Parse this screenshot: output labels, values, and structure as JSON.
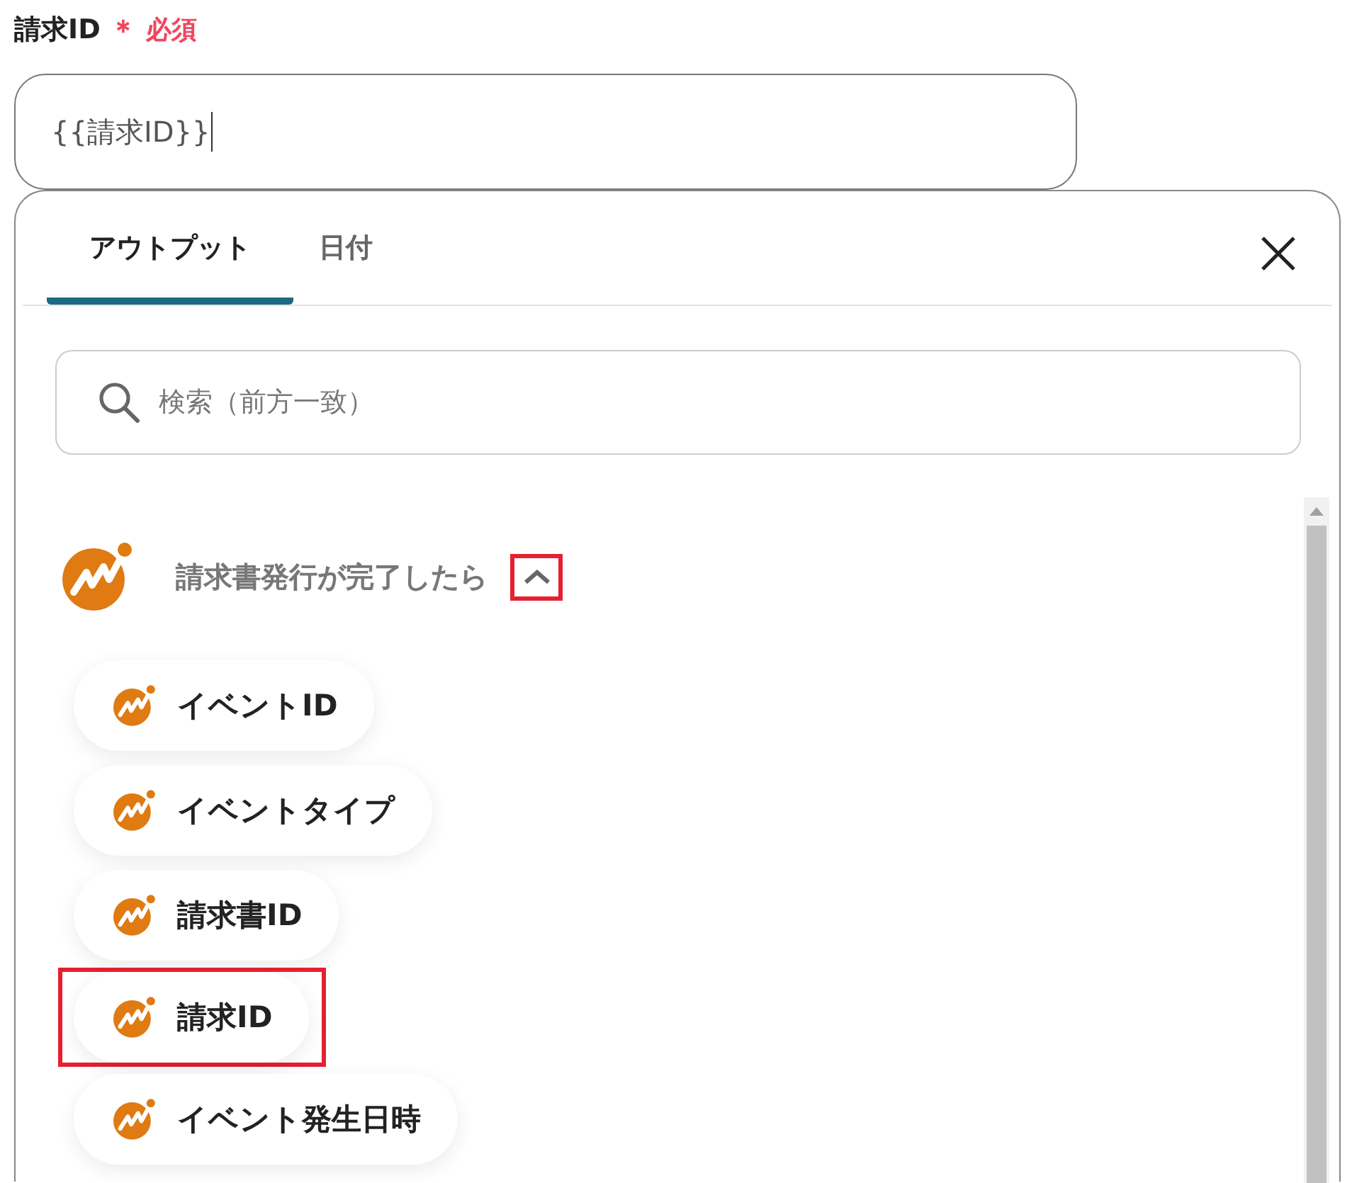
{
  "field": {
    "label": "請求ID",
    "required_mark": "＊",
    "required_text": "必須",
    "value": "{{請求ID}}"
  },
  "panel": {
    "tabs": [
      {
        "label": "アウトプット",
        "selected": true
      },
      {
        "label": "日付",
        "selected": false
      }
    ],
    "search": {
      "placeholder": "検索（前方一致）"
    },
    "group": {
      "title": "請求書発行が完了したら",
      "expanded": true,
      "toggle_highlighted": true,
      "items": [
        {
          "label": "イベントID",
          "highlighted": false
        },
        {
          "label": "イベントタイプ",
          "highlighted": false
        },
        {
          "label": "請求書ID",
          "highlighted": false
        },
        {
          "label": "請求ID",
          "highlighted": true
        },
        {
          "label": "イベント発生日時",
          "highlighted": false
        }
      ]
    }
  }
}
